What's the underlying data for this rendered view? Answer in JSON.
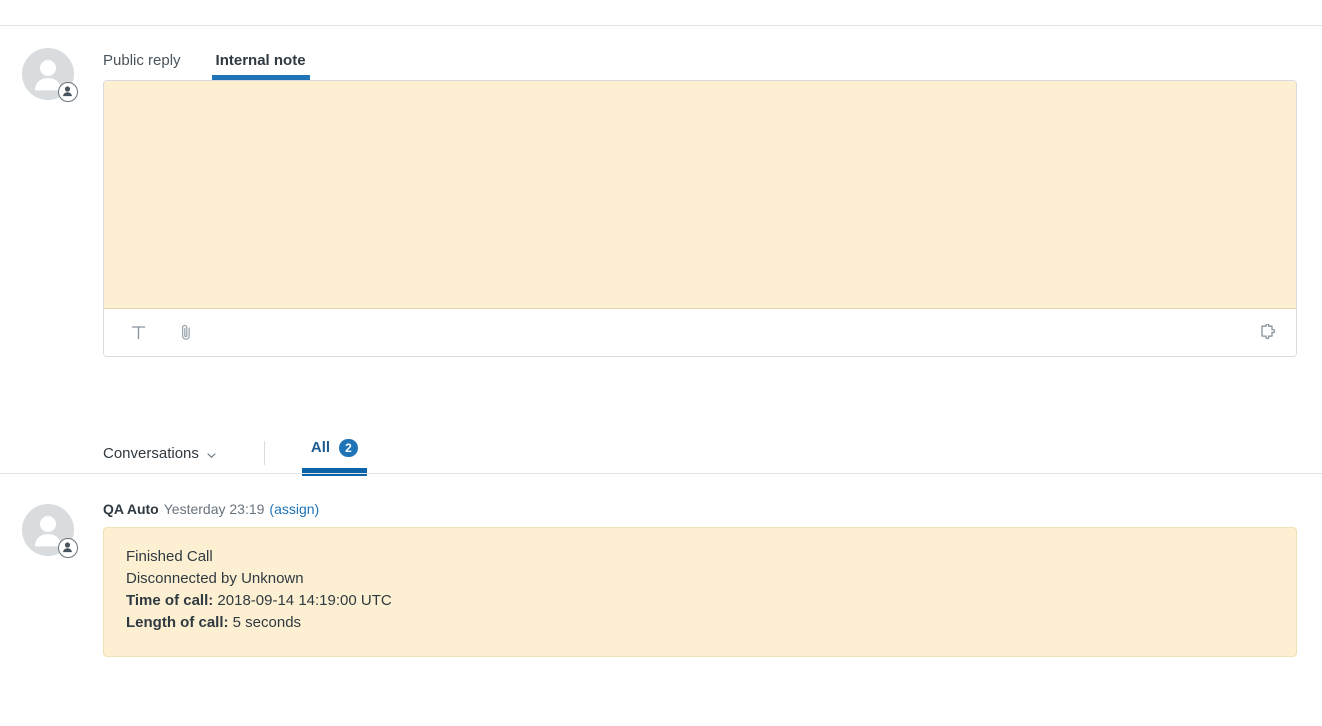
{
  "colors": {
    "accent_blue": "#1f73b7",
    "tab_underline": "#0b63a8",
    "note_background": "#fdf0d2",
    "note_border": "#f2e1b4",
    "divider": "#e0e3e6",
    "avatar_grey": "#d8dcde",
    "text_primary": "#2f3941",
    "text_muted": "#68737d"
  },
  "composer": {
    "avatar": {
      "icon": "user-avatar-icon",
      "badge_icon": "end-user-badge-icon"
    },
    "tabs": [
      {
        "label": "Public reply",
        "active": false,
        "name": "tab-public-reply"
      },
      {
        "label": "Internal note",
        "active": true,
        "name": "tab-internal-note"
      }
    ],
    "editor": {
      "value": "",
      "placeholder": ""
    },
    "toolbar": {
      "text_format_icon": "text-format-icon",
      "text_format_glyph": "T",
      "attachment_icon": "attachment-paperclip-icon",
      "apps_icon": "apps-puzzle-piece-icon"
    }
  },
  "conversation_bar": {
    "filter_label": "Conversations",
    "filter_caret_icon": "chevron-down-icon",
    "all_tab": {
      "label": "All",
      "count": "2"
    }
  },
  "messages": [
    {
      "avatar_icon": "user-avatar-icon",
      "avatar_badge_icon": "end-user-badge-icon",
      "author": "QA Auto",
      "timestamp": "Yesterday 23:19",
      "assign_link": "(assign)",
      "lines": [
        {
          "label": "",
          "text": "Finished Call"
        },
        {
          "label": "",
          "text": "Disconnected by Unknown"
        },
        {
          "label": "Time of call:",
          "text": "2018-09-14 14:19:00 UTC"
        },
        {
          "label": "Length of call:",
          "text": "5 seconds"
        }
      ]
    }
  ]
}
